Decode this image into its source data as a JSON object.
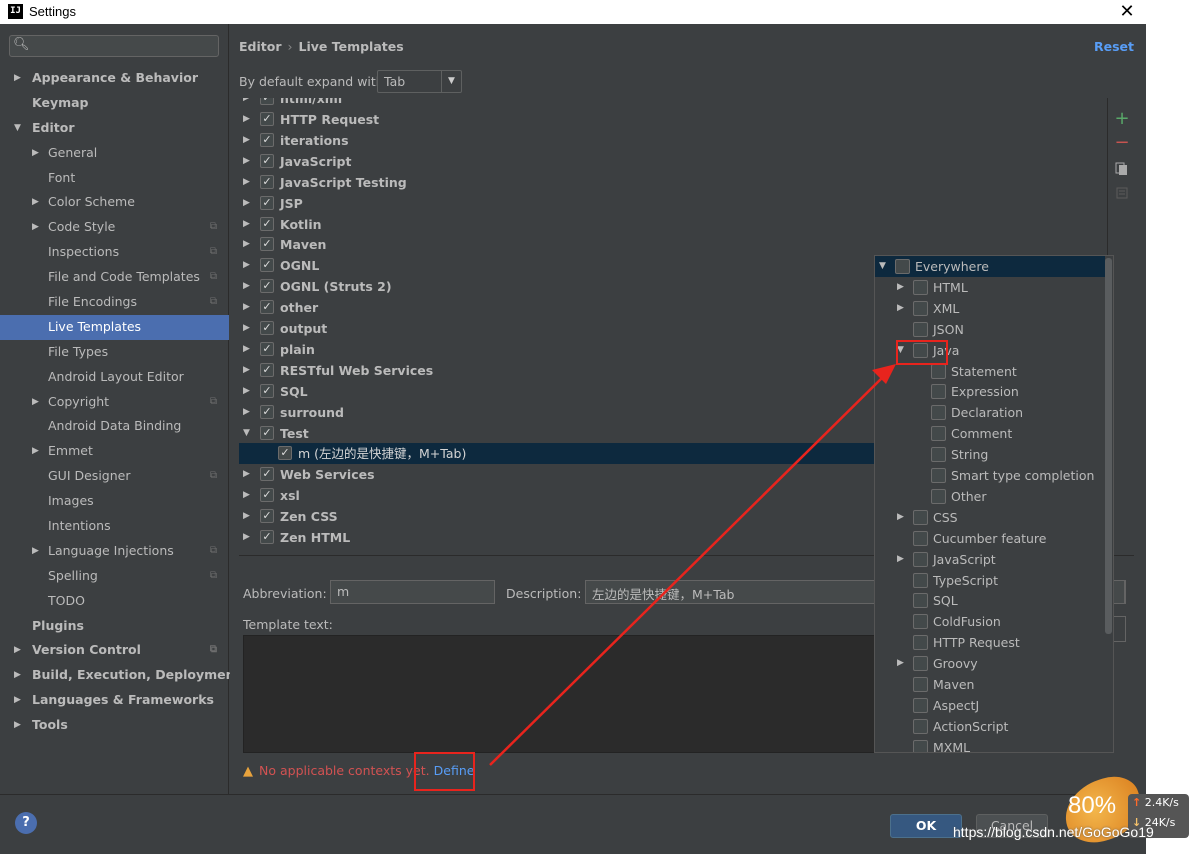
{
  "window": {
    "title": "Settings",
    "close_symbol": "✕",
    "app_icon_text": "IJ"
  },
  "search": {
    "icon": "search-icon",
    "value": ""
  },
  "sidebar": {
    "items": [
      {
        "label": "Appearance & Behavior",
        "level": 1,
        "bold": true,
        "arrow": "collapsed"
      },
      {
        "label": "Keymap",
        "level": 1,
        "bold": true
      },
      {
        "label": "Editor",
        "level": 1,
        "bold": true,
        "arrow": "expanded"
      },
      {
        "label": "General",
        "level": 2,
        "arrow": "collapsed"
      },
      {
        "label": "Font",
        "level": 2
      },
      {
        "label": "Color Scheme",
        "level": 2,
        "arrow": "collapsed"
      },
      {
        "label": "Code Style",
        "level": 2,
        "arrow": "collapsed",
        "project": true
      },
      {
        "label": "Inspections",
        "level": 2,
        "project": true
      },
      {
        "label": "File and Code Templates",
        "level": 2,
        "project": true
      },
      {
        "label": "File Encodings",
        "level": 2,
        "project": true
      },
      {
        "label": "Live Templates",
        "level": 2,
        "selected": true
      },
      {
        "label": "File Types",
        "level": 2
      },
      {
        "label": "Android Layout Editor",
        "level": 2
      },
      {
        "label": "Copyright",
        "level": 2,
        "arrow": "collapsed",
        "project": true
      },
      {
        "label": "Android Data Binding",
        "level": 2
      },
      {
        "label": "Emmet",
        "level": 2,
        "arrow": "collapsed"
      },
      {
        "label": "GUI Designer",
        "level": 2,
        "project": true
      },
      {
        "label": "Images",
        "level": 2
      },
      {
        "label": "Intentions",
        "level": 2
      },
      {
        "label": "Language Injections",
        "level": 2,
        "arrow": "collapsed",
        "project": true
      },
      {
        "label": "Spelling",
        "level": 2,
        "project": true
      },
      {
        "label": "TODO",
        "level": 2
      },
      {
        "label": "Plugins",
        "level": 1,
        "bold": true
      },
      {
        "label": "Version Control",
        "level": 1,
        "bold": true,
        "arrow": "collapsed",
        "project": true
      },
      {
        "label": "Build, Execution, Deployment",
        "level": 1,
        "bold": true,
        "arrow": "collapsed"
      },
      {
        "label": "Languages & Frameworks",
        "level": 1,
        "bold": true,
        "arrow": "collapsed"
      },
      {
        "label": "Tools",
        "level": 1,
        "bold": true,
        "arrow": "collapsed"
      }
    ]
  },
  "main": {
    "breadcrumb": {
      "parent": "Editor",
      "separator": "›",
      "current": "Live Templates"
    },
    "reset_label": "Reset",
    "expand_label": "By default expand with",
    "expand_value": "Tab",
    "tree_partial_top": "html/xml",
    "tree": [
      {
        "label": "HTTP Request",
        "checked": true,
        "arrow": "collapsed"
      },
      {
        "label": "iterations",
        "checked": true,
        "arrow": "collapsed"
      },
      {
        "label": "JavaScript",
        "checked": true,
        "arrow": "collapsed"
      },
      {
        "label": "JavaScript Testing",
        "checked": true,
        "arrow": "collapsed"
      },
      {
        "label": "JSP",
        "checked": true,
        "arrow": "collapsed"
      },
      {
        "label": "Kotlin",
        "checked": true,
        "arrow": "collapsed"
      },
      {
        "label": "Maven",
        "checked": true,
        "arrow": "collapsed"
      },
      {
        "label": "OGNL",
        "checked": true,
        "arrow": "collapsed"
      },
      {
        "label": "OGNL (Struts 2)",
        "checked": true,
        "arrow": "collapsed"
      },
      {
        "label": "other",
        "checked": true,
        "arrow": "collapsed"
      },
      {
        "label": "output",
        "checked": true,
        "arrow": "collapsed"
      },
      {
        "label": "plain",
        "checked": true,
        "arrow": "collapsed"
      },
      {
        "label": "RESTful Web Services",
        "checked": true,
        "arrow": "collapsed"
      },
      {
        "label": "SQL",
        "checked": true,
        "arrow": "collapsed"
      },
      {
        "label": "surround",
        "checked": true,
        "arrow": "collapsed"
      },
      {
        "label": "Test",
        "checked": true,
        "arrow": "expanded"
      },
      {
        "label": "m (左边的是快捷键，M+Tab)",
        "checked": true,
        "child": true,
        "selected": true
      },
      {
        "label": "Web Services",
        "checked": true,
        "arrow": "collapsed"
      },
      {
        "label": "xsl",
        "checked": true,
        "arrow": "collapsed"
      },
      {
        "label": "Zen CSS",
        "checked": true,
        "arrow": "collapsed"
      },
      {
        "label": "Zen HTML",
        "checked": true,
        "arrow": "collapsed"
      }
    ],
    "toolbar": {
      "add": "+",
      "remove": "−"
    },
    "abbreviation_label": "Abbreviation:",
    "abbreviation_value": "m",
    "description_label": "Description:",
    "description_value": "左边的是快捷键，M+Tab",
    "template_text_label": "Template text:",
    "template_text_value": "",
    "warning_text": "No applicable contexts yet.",
    "define_label": "Define"
  },
  "context_popup": {
    "items": [
      {
        "label": "Everywhere",
        "level": 0,
        "arrow": "expanded",
        "header": true
      },
      {
        "label": "HTML",
        "level": 1,
        "arrow": "collapsed"
      },
      {
        "label": "XML",
        "level": 1,
        "arrow": "collapsed"
      },
      {
        "label": "JSON",
        "level": 1
      },
      {
        "label": "Java",
        "level": 1,
        "arrow": "expanded"
      },
      {
        "label": "Statement",
        "level": 2
      },
      {
        "label": "Expression",
        "level": 2
      },
      {
        "label": "Declaration",
        "level": 2
      },
      {
        "label": "Comment",
        "level": 2
      },
      {
        "label": "String",
        "level": 2
      },
      {
        "label": "Smart type completion",
        "level": 2
      },
      {
        "label": "Other",
        "level": 2
      },
      {
        "label": "CSS",
        "level": 1,
        "arrow": "collapsed"
      },
      {
        "label": "Cucumber feature",
        "level": 1
      },
      {
        "label": "JavaScript",
        "level": 1,
        "arrow": "collapsed"
      },
      {
        "label": "TypeScript",
        "level": 1
      },
      {
        "label": "SQL",
        "level": 1
      },
      {
        "label": "ColdFusion",
        "level": 1
      },
      {
        "label": "HTTP Request",
        "level": 1
      },
      {
        "label": "Groovy",
        "level": 1,
        "arrow": "collapsed"
      },
      {
        "label": "Maven",
        "level": 1
      },
      {
        "label": "AspectJ",
        "level": 1
      },
      {
        "label": "ActionScript",
        "level": 1
      },
      {
        "label": "MXML",
        "level": 1
      }
    ]
  },
  "buttons": {
    "help": "?",
    "ok": "OK",
    "cancel": "Cancel"
  },
  "overlay": {
    "badge_percent": "80%",
    "upload_speed": "2.4K/s",
    "download_speed": "24K/s",
    "watermark": "https://blog.csdn.net/GoGoGo19"
  },
  "colors": {
    "background": "#3c3f41",
    "selection": "#4b6eaf",
    "accent_link": "#589df6",
    "annotation_red": "#e8241d",
    "warning": "#d25252"
  }
}
